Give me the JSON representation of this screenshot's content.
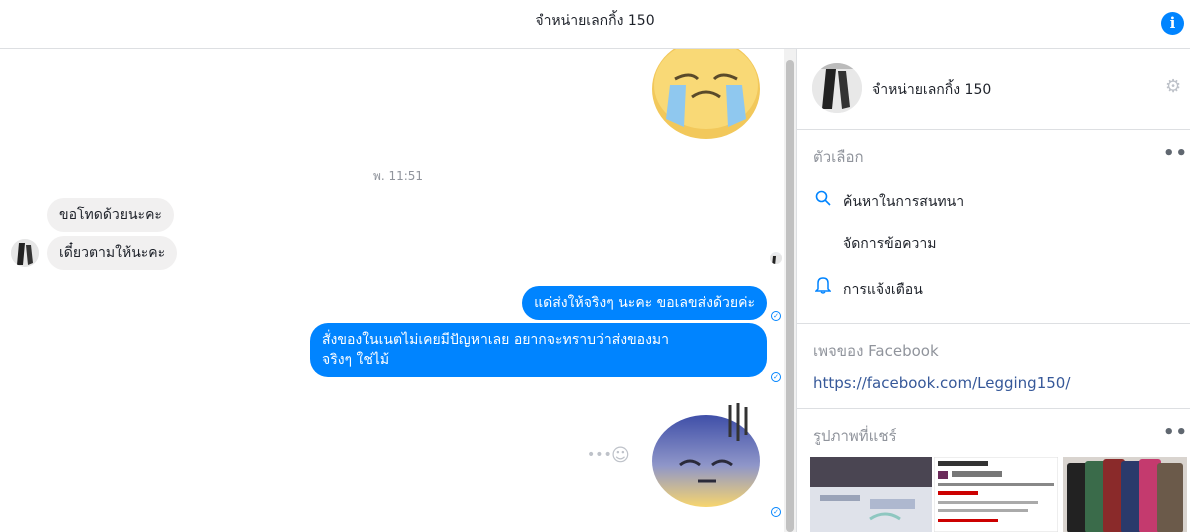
{
  "header": {
    "title": "จำหน่ายเลกกิ้ง 150"
  },
  "chat": {
    "timestamp": "พ. 11:51",
    "incoming": [
      {
        "text": "ขอโทดด้วยนะคะ"
      },
      {
        "text": "เดี๋ยวตามให้นะคะ"
      }
    ],
    "outgoing": [
      {
        "text": "แด่ส่งให้จริงๆ นะคะ ขอเลขส่งด้วยค่ะ"
      },
      {
        "text": "สั่งของในเนตไม่เคยมีปัญหาเลย อยากจะทราบว่าส่งของมา\nจริงๆ ใช่ไม้"
      }
    ],
    "more_label": "•••",
    "emoji_label": "☺"
  },
  "panel": {
    "page_name": "จำหน่ายเลกกิ้ง 150",
    "options_title": "ตัวเลือก",
    "options": [
      {
        "label": "ค้นหาในการสนทนา",
        "icon": "search-icon"
      },
      {
        "label": "จัดการข้อความ",
        "icon": ""
      },
      {
        "label": "การแจ้งเตือน",
        "icon": "bell-icon"
      }
    ],
    "fb_page_title": "เพจของ Facebook",
    "fb_link": "https://facebook.com/Legging150/",
    "shared_photos_title": "รูปภาพที่แชร์",
    "more_label": "•••"
  },
  "colors": {
    "accent": "#0084ff",
    "incoming_bubble": "#f1f0f0",
    "link": "#365899"
  }
}
